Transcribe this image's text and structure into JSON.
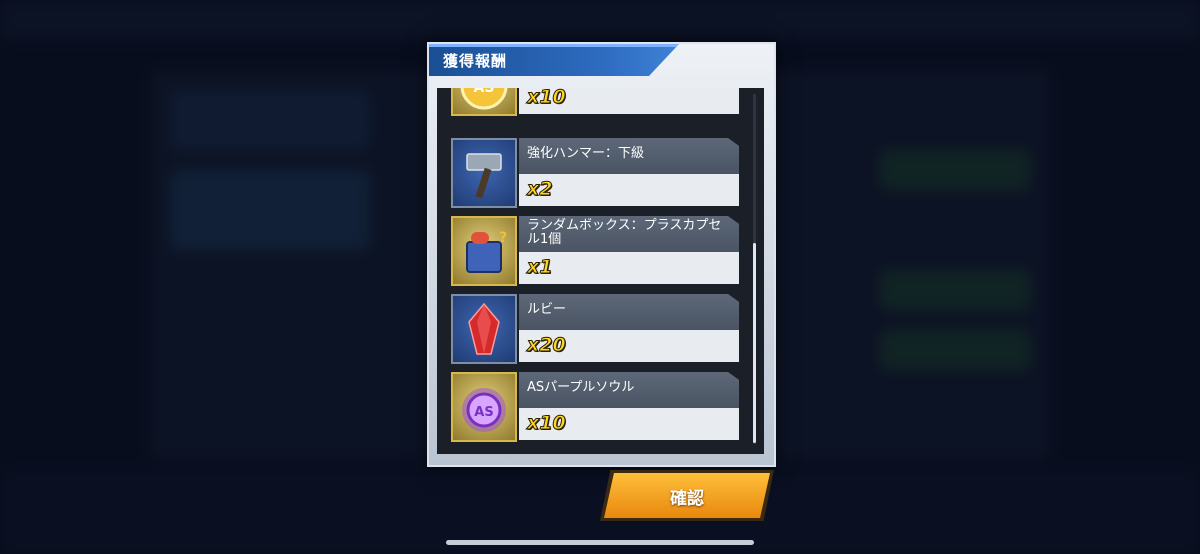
{
  "dialog": {
    "title": "獲得報酬",
    "items": [
      {
        "name": "",
        "quantity": "x10",
        "icon": "gold-coin-icon"
      },
      {
        "name": "強化ハンマー：下級",
        "quantity": "x2",
        "icon": "hammer-icon"
      },
      {
        "name": "ランダムボックス：プラスカプセル1個",
        "quantity": "x1",
        "icon": "capsule-box-icon"
      },
      {
        "name": "ルビー",
        "quantity": "x20",
        "icon": "ruby-icon"
      },
      {
        "name": "ASパープルソウル",
        "quantity": "x10",
        "icon": "purple-soul-icon"
      }
    ]
  },
  "confirm": {
    "label": "確認"
  },
  "colors": {
    "accent": "#2e6cc0",
    "button": "#f2a321",
    "quantity": "#ffd52a"
  }
}
